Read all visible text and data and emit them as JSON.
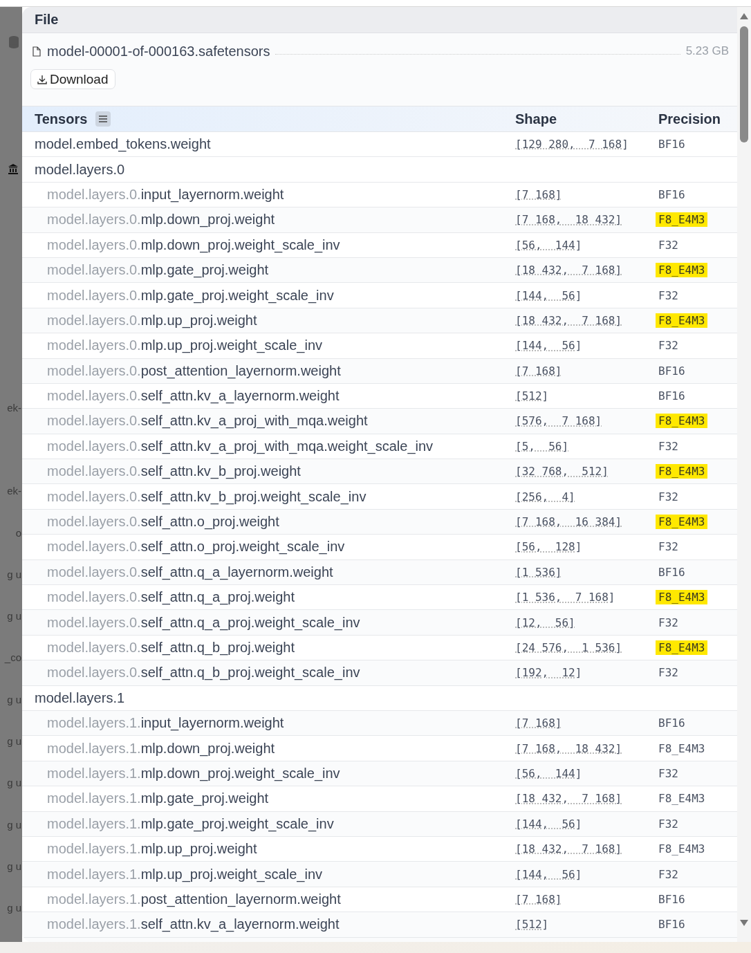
{
  "background_fragments": [
    "ek-",
    "ek-",
    "o",
    "g u",
    "g u",
    "_co",
    "g u",
    "g u",
    "g u",
    "g u",
    "g u",
    "g u"
  ],
  "panel": {
    "title": "File",
    "file_name": "model-00001-of-000163.safetensors",
    "file_size": "5.23 GB",
    "download_label": "Download"
  },
  "table": {
    "columns": [
      "Tensors",
      "Shape",
      "Precision"
    ],
    "rows": [
      {
        "kind": "tensor",
        "prefix": "",
        "name": "model.embed_tokens.weight",
        "shape": "[129 280,  7 168]",
        "precision": "BF16",
        "highlighted": false
      },
      {
        "kind": "group",
        "name": "model.layers.0"
      },
      {
        "kind": "tensor",
        "prefix": "model.layers.0.",
        "name": "input_layernorm.weight",
        "shape": "[7 168]",
        "precision": "BF16",
        "highlighted": false
      },
      {
        "kind": "tensor",
        "prefix": "model.layers.0.",
        "name": "mlp.down_proj.weight",
        "shape": "[7 168,  18 432]",
        "precision": "F8_E4M3",
        "highlighted": true
      },
      {
        "kind": "tensor",
        "prefix": "model.layers.0.",
        "name": "mlp.down_proj.weight_scale_inv",
        "shape": "[56,  144]",
        "precision": "F32",
        "highlighted": false
      },
      {
        "kind": "tensor",
        "prefix": "model.layers.0.",
        "name": "mlp.gate_proj.weight",
        "shape": "[18 432,  7 168]",
        "precision": "F8_E4M3",
        "highlighted": true
      },
      {
        "kind": "tensor",
        "prefix": "model.layers.0.",
        "name": "mlp.gate_proj.weight_scale_inv",
        "shape": "[144,  56]",
        "precision": "F32",
        "highlighted": false
      },
      {
        "kind": "tensor",
        "prefix": "model.layers.0.",
        "name": "mlp.up_proj.weight",
        "shape": "[18 432,  7 168]",
        "precision": "F8_E4M3",
        "highlighted": true
      },
      {
        "kind": "tensor",
        "prefix": "model.layers.0.",
        "name": "mlp.up_proj.weight_scale_inv",
        "shape": "[144,  56]",
        "precision": "F32",
        "highlighted": false
      },
      {
        "kind": "tensor",
        "prefix": "model.layers.0.",
        "name": "post_attention_layernorm.weight",
        "shape": "[7 168]",
        "precision": "BF16",
        "highlighted": false
      },
      {
        "kind": "tensor",
        "prefix": "model.layers.0.",
        "name": "self_attn.kv_a_layernorm.weight",
        "shape": "[512]",
        "precision": "BF16",
        "highlighted": false
      },
      {
        "kind": "tensor",
        "prefix": "model.layers.0.",
        "name": "self_attn.kv_a_proj_with_mqa.weight",
        "shape": "[576,  7 168]",
        "precision": "F8_E4M3",
        "highlighted": true
      },
      {
        "kind": "tensor",
        "prefix": "model.layers.0.",
        "name": "self_attn.kv_a_proj_with_mqa.weight_scale_inv",
        "shape": "[5,  56]",
        "precision": "F32",
        "highlighted": false
      },
      {
        "kind": "tensor",
        "prefix": "model.layers.0.",
        "name": "self_attn.kv_b_proj.weight",
        "shape": "[32 768,  512]",
        "precision": "F8_E4M3",
        "highlighted": true
      },
      {
        "kind": "tensor",
        "prefix": "model.layers.0.",
        "name": "self_attn.kv_b_proj.weight_scale_inv",
        "shape": "[256,  4]",
        "precision": "F32",
        "highlighted": false
      },
      {
        "kind": "tensor",
        "prefix": "model.layers.0.",
        "name": "self_attn.o_proj.weight",
        "shape": "[7 168,  16 384]",
        "precision": "F8_E4M3",
        "highlighted": true
      },
      {
        "kind": "tensor",
        "prefix": "model.layers.0.",
        "name": "self_attn.o_proj.weight_scale_inv",
        "shape": "[56,  128]",
        "precision": "F32",
        "highlighted": false
      },
      {
        "kind": "tensor",
        "prefix": "model.layers.0.",
        "name": "self_attn.q_a_layernorm.weight",
        "shape": "[1 536]",
        "precision": "BF16",
        "highlighted": false
      },
      {
        "kind": "tensor",
        "prefix": "model.layers.0.",
        "name": "self_attn.q_a_proj.weight",
        "shape": "[1 536,  7 168]",
        "precision": "F8_E4M3",
        "highlighted": true
      },
      {
        "kind": "tensor",
        "prefix": "model.layers.0.",
        "name": "self_attn.q_a_proj.weight_scale_inv",
        "shape": "[12,  56]",
        "precision": "F32",
        "highlighted": false
      },
      {
        "kind": "tensor",
        "prefix": "model.layers.0.",
        "name": "self_attn.q_b_proj.weight",
        "shape": "[24 576,  1 536]",
        "precision": "F8_E4M3",
        "highlighted": true
      },
      {
        "kind": "tensor",
        "prefix": "model.layers.0.",
        "name": "self_attn.q_b_proj.weight_scale_inv",
        "shape": "[192,  12]",
        "precision": "F32",
        "highlighted": false
      },
      {
        "kind": "group",
        "name": "model.layers.1"
      },
      {
        "kind": "tensor",
        "prefix": "model.layers.1.",
        "name": "input_layernorm.weight",
        "shape": "[7 168]",
        "precision": "BF16",
        "highlighted": false
      },
      {
        "kind": "tensor",
        "prefix": "model.layers.1.",
        "name": "mlp.down_proj.weight",
        "shape": "[7 168,  18 432]",
        "precision": "F8_E4M3",
        "highlighted": false
      },
      {
        "kind": "tensor",
        "prefix": "model.layers.1.",
        "name": "mlp.down_proj.weight_scale_inv",
        "shape": "[56,  144]",
        "precision": "F32",
        "highlighted": false
      },
      {
        "kind": "tensor",
        "prefix": "model.layers.1.",
        "name": "mlp.gate_proj.weight",
        "shape": "[18 432,  7 168]",
        "precision": "F8_E4M3",
        "highlighted": false
      },
      {
        "kind": "tensor",
        "prefix": "model.layers.1.",
        "name": "mlp.gate_proj.weight_scale_inv",
        "shape": "[144,  56]",
        "precision": "F32",
        "highlighted": false
      },
      {
        "kind": "tensor",
        "prefix": "model.layers.1.",
        "name": "mlp.up_proj.weight",
        "shape": "[18 432,  7 168]",
        "precision": "F8_E4M3",
        "highlighted": false
      },
      {
        "kind": "tensor",
        "prefix": "model.layers.1.",
        "name": "mlp.up_proj.weight_scale_inv",
        "shape": "[144,  56]",
        "precision": "F32",
        "highlighted": false
      },
      {
        "kind": "tensor",
        "prefix": "model.layers.1.",
        "name": "post_attention_layernorm.weight",
        "shape": "[7 168]",
        "precision": "BF16",
        "highlighted": false
      },
      {
        "kind": "tensor",
        "prefix": "model.layers.1.",
        "name": "self_attn.kv_a_layernorm.weight",
        "shape": "[512]",
        "precision": "BF16",
        "highlighted": false
      }
    ]
  }
}
